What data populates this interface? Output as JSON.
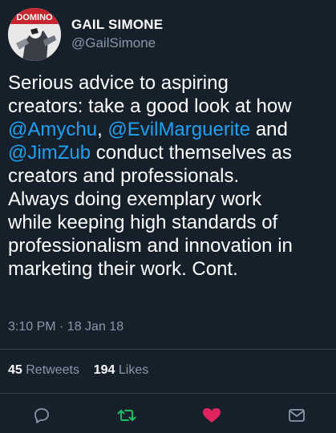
{
  "user": {
    "display_name": "GAIL SIMONE",
    "handle": "@GailSimone",
    "avatar_text": "DOMINO"
  },
  "tweet": {
    "segments": [
      {
        "text": "Serious advice to aspiring",
        "type": "text"
      },
      {
        "text": "creators: take a good look at how",
        "type": "text"
      },
      {
        "text": "@Amychu",
        "type": "mention"
      },
      {
        "text": ", ",
        "type": "text"
      },
      {
        "text": "@EvilMarguerite",
        "type": "mention"
      },
      {
        "text": " and",
        "type": "text"
      },
      {
        "text": "@JimZub",
        "type": "mention"
      },
      {
        "text": " conduct themselves as",
        "type": "text"
      },
      {
        "text": "creators and professionals.",
        "type": "text"
      },
      {
        "text": "Always doing exemplary work",
        "type": "text"
      },
      {
        "text": "while keeping high standards of",
        "type": "text"
      },
      {
        "text": "professionalism and innovation in",
        "type": "text"
      },
      {
        "text": "marketing their work. Cont.",
        "type": "text"
      }
    ],
    "timestamp": "3:10 PM · 18 Jan 18"
  },
  "stats": {
    "retweets_count": "45",
    "retweets_label": "Retweets",
    "likes_count": "194",
    "likes_label": "Likes"
  },
  "actions": {
    "reply_icon": "reply-icon",
    "retweet_icon": "retweet-icon",
    "like_icon": "heart-icon",
    "share_icon": "mail-icon"
  },
  "colors": {
    "background": "#15202b",
    "mention": "#1da1f2",
    "secondary_text": "#8899a6",
    "retweet_green": "#17bf63",
    "like_red": "#e0245e"
  }
}
